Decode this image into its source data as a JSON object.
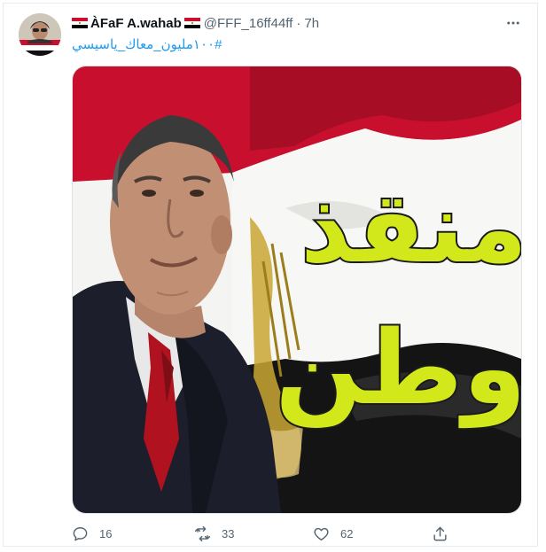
{
  "tweet": {
    "author": {
      "display_name": "ÀFaF A.wahab",
      "handle": "@FFF_16ff44ff",
      "avatar_icon": "profile-photo"
    },
    "separator": "·",
    "time": "7h",
    "text": "#١٠٠مليون_معاك_ياسيسي",
    "media": {
      "caption_word_1": "منقذ",
      "caption_word_2": "وطن",
      "caption_color": "#d2e81b",
      "flag_colors": [
        "#c8102e",
        "#ffffff",
        "#000000"
      ]
    },
    "metrics": {
      "replies": "16",
      "retweets": "33",
      "likes": "62"
    },
    "icons": {
      "reply": "reply-icon",
      "retweet": "retweet-icon",
      "like": "like-icon",
      "share": "share-icon",
      "more": "more-icon"
    }
  }
}
